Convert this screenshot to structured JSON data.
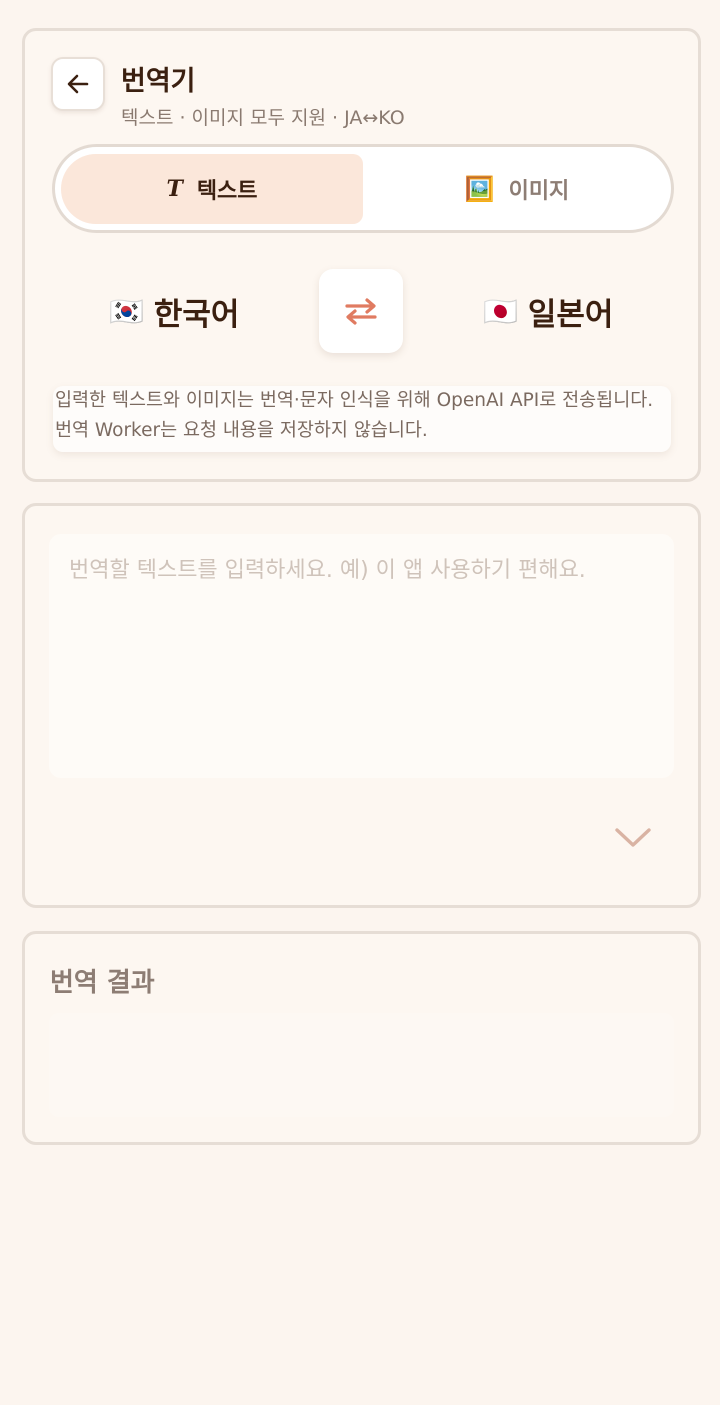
{
  "header": {
    "back_icon": "arrow-left-icon",
    "title": "번역기",
    "subtitle": "텍스트 · 이미지 모두 지원 · JA↔KO"
  },
  "mode_toggle": {
    "text_tab": {
      "icon": "T",
      "label": "텍스트",
      "active": true
    },
    "image_tab": {
      "icon": "🖼️",
      "label": "이미지",
      "active": false
    }
  },
  "languages": {
    "source": {
      "flag": "🇰🇷",
      "label": "한국어"
    },
    "swap_icon": "swap-arrows-icon",
    "target": {
      "flag": "🇯🇵",
      "label": "일본어"
    }
  },
  "notice": "입력한 텍스트와 이미지는 번역·문자 인식을 위해 OpenAI API로 전송됩니다. 번역 Worker는 요청 내용을 저장하지 않습니다.",
  "input": {
    "value": "",
    "placeholder": "번역할 텍스트를 입력하세요. 예) 이 앱 사용하기 편해요.",
    "expand_icon": "chevron-down-icon"
  },
  "result": {
    "title": "번역 결과",
    "text": ""
  },
  "colors": {
    "background": "#fcf5ef",
    "accent": "#e07b61",
    "active_tab": "#fbe7da",
    "title_text": "#3b2010"
  }
}
